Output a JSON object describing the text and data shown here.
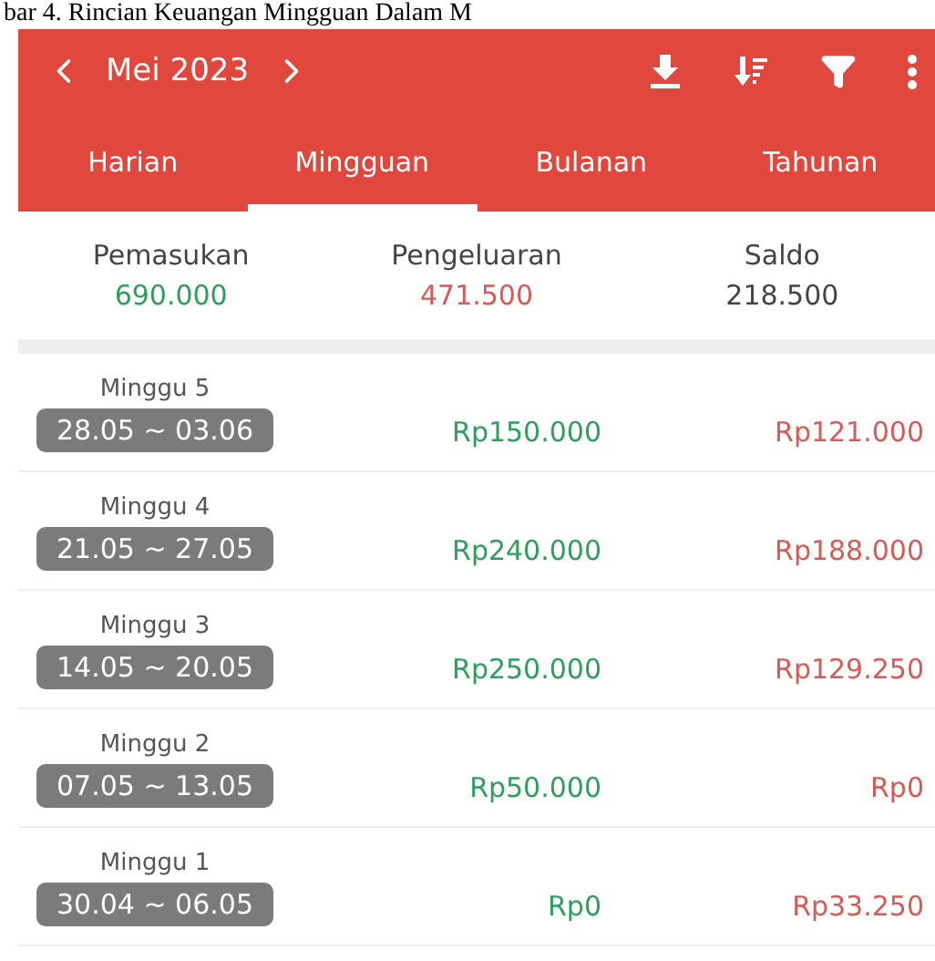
{
  "caption": "bar 4. Rincian Keuangan Mingguan Dalam M",
  "header": {
    "period": "Mei 2023"
  },
  "tabs": [
    {
      "label": "Harian",
      "selected": false
    },
    {
      "label": "Mingguan",
      "selected": true
    },
    {
      "label": "Bulanan",
      "selected": false
    },
    {
      "label": "Tahunan",
      "selected": false
    }
  ],
  "summary": [
    {
      "label": "Pemasukan",
      "value": "690.000",
      "kind": "income"
    },
    {
      "label": "Pengeluaran",
      "value": "471.500",
      "kind": "expense"
    },
    {
      "label": "Saldo",
      "value": "218.500",
      "kind": "balance"
    }
  ],
  "weeks": [
    {
      "name": "Minggu 5",
      "range": "28.05 ~ 03.06",
      "income": "Rp150.000",
      "expense": "Rp121.000"
    },
    {
      "name": "Minggu 4",
      "range": "21.05 ~ 27.05",
      "income": "Rp240.000",
      "expense": "Rp188.000"
    },
    {
      "name": "Minggu 3",
      "range": "14.05 ~ 20.05",
      "income": "Rp250.000",
      "expense": "Rp129.250"
    },
    {
      "name": "Minggu 2",
      "range": "07.05 ~ 13.05",
      "income": "Rp50.000",
      "expense": "Rp0"
    },
    {
      "name": "Minggu 1",
      "range": "30.04 ~ 06.05",
      "income": "Rp0",
      "expense": "Rp33.250"
    }
  ]
}
